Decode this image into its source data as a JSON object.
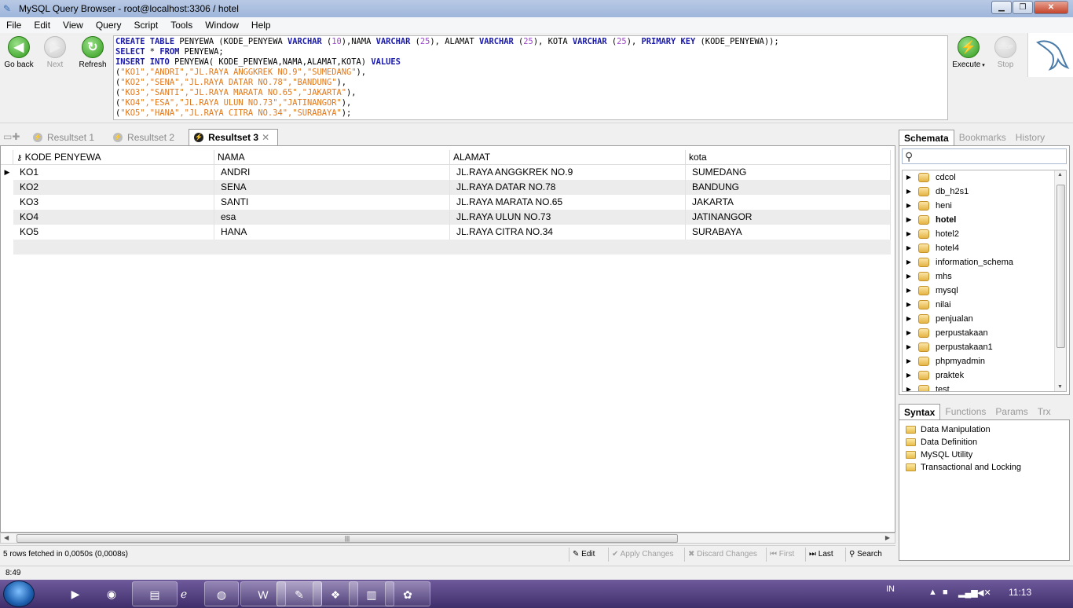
{
  "window": {
    "title": "MySQL Query Browser - root@localhost:3306 / hotel",
    "minimize": "▁",
    "maximize": "❐",
    "close": "✕"
  },
  "menubar": [
    "File",
    "Edit",
    "View",
    "Query",
    "Script",
    "Tools",
    "Window",
    "Help"
  ],
  "toolbar": {
    "go_back": "Go back",
    "next": "Next",
    "refresh": "Refresh",
    "execute": "Execute",
    "stop": "Stop",
    "stop_icon_text": "STOP"
  },
  "sql_lines": [
    "CREATE TABLE PENYEWA (KODE_PENYEWA VARCHAR (10),NAMA VARCHAR (25), ALAMAT VARCHAR (25), KOTA VARCHAR (25), PRIMARY KEY (KODE_PENYEWA));",
    "SELECT * FROM PENYEWA;",
    "INSERT INTO PENYEWA( KODE_PENYEWA,NAMA,ALAMAT,KOTA) VALUES",
    "(\"KO1\",\"ANDRI\",\"JL.RAYA ANGGKREK NO.9\",\"SUMEDANG\"),",
    "(\"KO2\",\"SENA\",\"JL.RAYA DATAR NO.78\",\"BANDUNG\"),",
    "(\"KO3\",\"SANTI\",\"JL.RAYA MARATA NO.65\",\"JAKARTA\"),",
    "(\"KO4\",\"ESA\",\"JL.RAYA ULUN NO.73\",\"JATINANGOR\"),",
    "(\"KO5\",\"HANA\",\"JL.RAYA CITRA NO.34\",\"SURABAYA\");"
  ],
  "result_tabs": [
    {
      "label": "Resultset 1",
      "active": false
    },
    {
      "label": "Resultset 2",
      "active": false
    },
    {
      "label": "Resultset 3",
      "active": true
    }
  ],
  "grid": {
    "columns": [
      "KODE PENYEWA",
      "NAMA",
      "ALAMAT",
      "kota"
    ],
    "rows": [
      [
        "KO1",
        "ANDRI",
        "JL.RAYA ANGGKREK NO.9",
        "SUMEDANG"
      ],
      [
        "KO2",
        "SENA",
        "JL.RAYA DATAR NO.78",
        "BANDUNG"
      ],
      [
        "KO3",
        "SANTI",
        "JL.RAYA MARATA NO.65",
        "JAKARTA"
      ],
      [
        "KO4",
        "esa",
        "JL.RAYA ULUN NO.73",
        "JATINANGOR"
      ],
      [
        "KO5",
        "HANA",
        "JL.RAYA CITRA NO.34",
        "SURABAYA"
      ]
    ],
    "status": "5 rows fetched in 0,0050s (0,0008s)",
    "buttons": {
      "edit": "Edit",
      "apply": "Apply Changes",
      "discard": "Discard Changes",
      "first": "First",
      "last": "Last",
      "search": "Search"
    }
  },
  "schemata": {
    "tabs": [
      "Schemata",
      "Bookmarks",
      "History"
    ],
    "databases": [
      "cdcol",
      "db_h2s1",
      "heni",
      "hotel",
      "hotel2",
      "hotel4",
      "information_schema",
      "mhs",
      "mysql",
      "nilai",
      "penjualan",
      "perpustakaan",
      "perpustakaan1",
      "phpmyadmin",
      "praktek",
      "test"
    ],
    "active_db": "hotel"
  },
  "syntax": {
    "tabs": [
      "Syntax",
      "Functions",
      "Params",
      "Trx"
    ],
    "items": [
      "Data Manipulation",
      "Data Definition",
      "MySQL Utility",
      "Transactional and Locking"
    ]
  },
  "statusbar": {
    "position": "8:49"
  },
  "taskbar": {
    "language": "IN",
    "clock": "11:13"
  }
}
